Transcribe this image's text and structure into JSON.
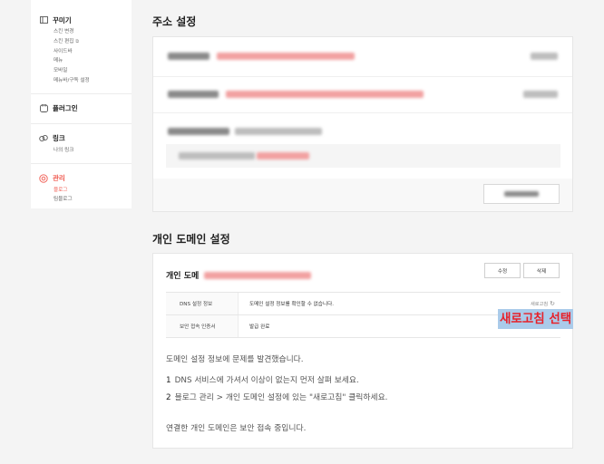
{
  "sidebar": {
    "decorate": {
      "label": "꾸미기",
      "items": [
        "스킨 변경",
        "스킨 편집",
        "사이드바",
        "메뉴",
        "모바일",
        "메뉴바/구독 설정"
      ]
    },
    "plugin": {
      "label": "플러그인"
    },
    "link": {
      "label": "링크",
      "items": [
        "나의 링크"
      ]
    },
    "manage": {
      "label": "관리",
      "items": [
        "블로그",
        "팀블로그"
      ]
    }
  },
  "address_section": {
    "title": "주소 설정"
  },
  "domain_section": {
    "title": "개인 도메인 설정",
    "domain_label": "개인 도메",
    "edit_button": "수정",
    "delete_button": "삭제",
    "table": [
      {
        "key": "DNS 설정 정보",
        "value": "도메인 설정 정보를 확인할 수 없습니다.",
        "action": "새로고침"
      },
      {
        "key": "보안 접속 인증서",
        "value": "발급 완료"
      }
    ],
    "help_intro": "도메인 설정 정보에 문제를 발견했습니다.",
    "help_steps": [
      {
        "num": "1",
        "text": "DNS 서비스에 가셔서 이상이 없는지 먼저 살펴 보세요."
      },
      {
        "num": "2",
        "text": "블로그 관리 > 개인 도메인 설정에 있는 \"새로고침\" 클릭하세요."
      }
    ],
    "secure_status": "연결한 개인 도메인은 보안 접속 중입니다."
  },
  "annotation": {
    "text": "새로고침 선택",
    "text_color": "#e7212a",
    "background": "#aacbea"
  },
  "colors": {
    "accent": "#f05a50"
  }
}
